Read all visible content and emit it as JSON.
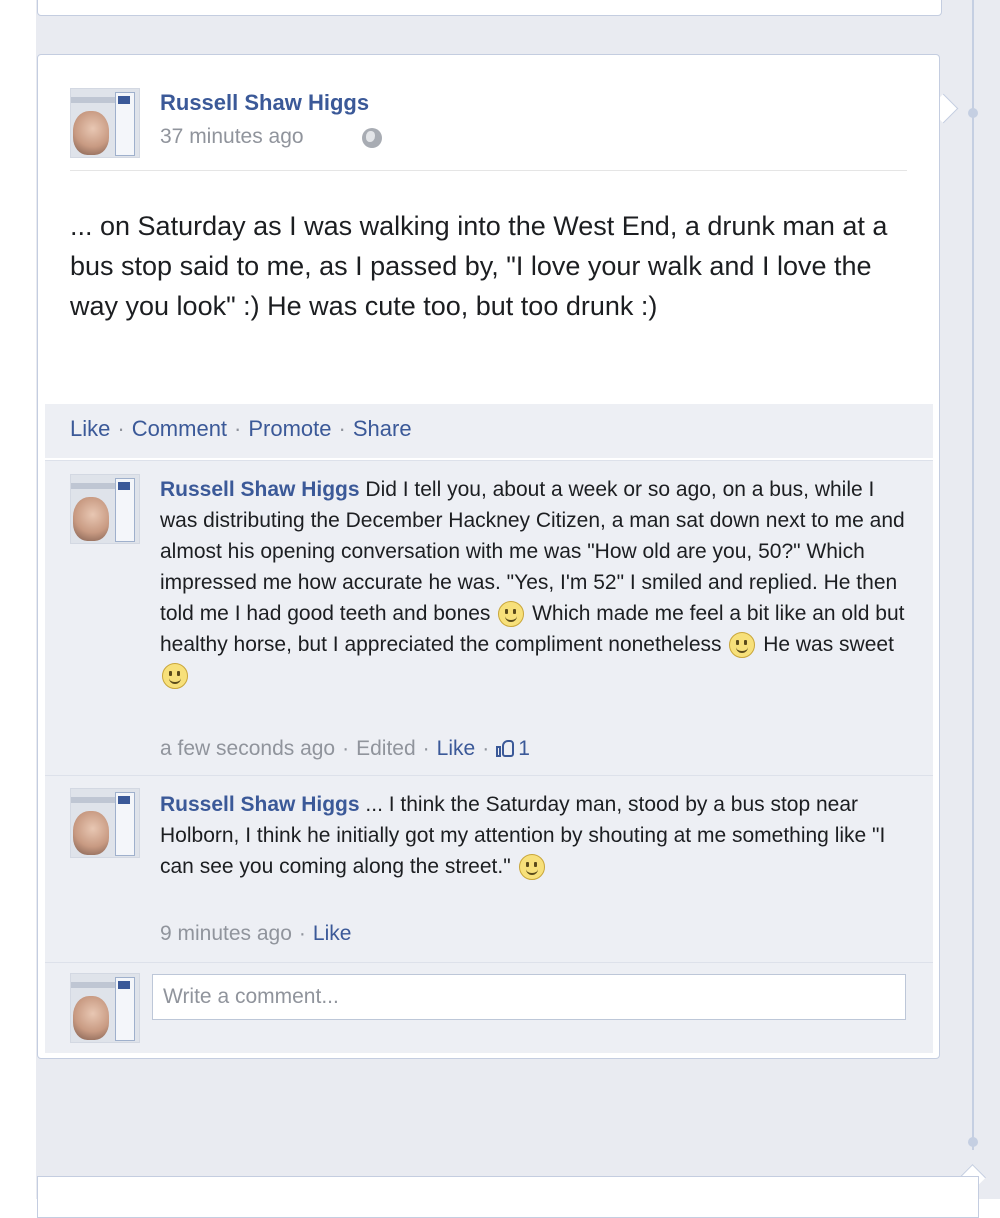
{
  "post": {
    "author": "Russell Shaw Higgs",
    "timestamp": "37 minutes ago",
    "privacy_icon": "globe-icon",
    "body": "... on Saturday as I was walking into the West End, a drunk man at a bus stop said to me, as I passed by, \"I love your walk and I love the way you look\" :) He was cute too, but too drunk :)"
  },
  "actions": {
    "like": "Like",
    "comment": "Comment",
    "promote": "Promote",
    "share": "Share",
    "separator": "·"
  },
  "comments": [
    {
      "author": "Russell Shaw Higgs",
      "text_1": " Did I tell you, about a week or so ago, on a bus, while I was distributing the December Hackney Citizen, a man sat down next to me and almost his opening conversation with me was \"How old are you, 50?\" Which impressed me how accurate he was. \"Yes, I'm 52\" I smiled and replied. He then told me I had good teeth and bones ",
      "text_2": " Which made me feel a bit like an old but healthy horse, but I appreciated the compliment nonetheless ",
      "text_3": " He was sweet ",
      "time": "a few seconds ago",
      "edited": "Edited",
      "like_label": "Like",
      "like_count": "1"
    },
    {
      "author": "Russell Shaw Higgs",
      "text_1": " ... I think the Saturday man, stood by a bus stop near Holborn, I think he initially got my attention by shouting at me something like \"I can see you coming along the street.\" ",
      "time": "9 minutes ago",
      "like_label": "Like"
    }
  ],
  "composer": {
    "placeholder": "Write a comment..."
  },
  "colors": {
    "link": "#3b5998",
    "muted": "#90949c",
    "timeline_bg": "#e9ebf1"
  }
}
